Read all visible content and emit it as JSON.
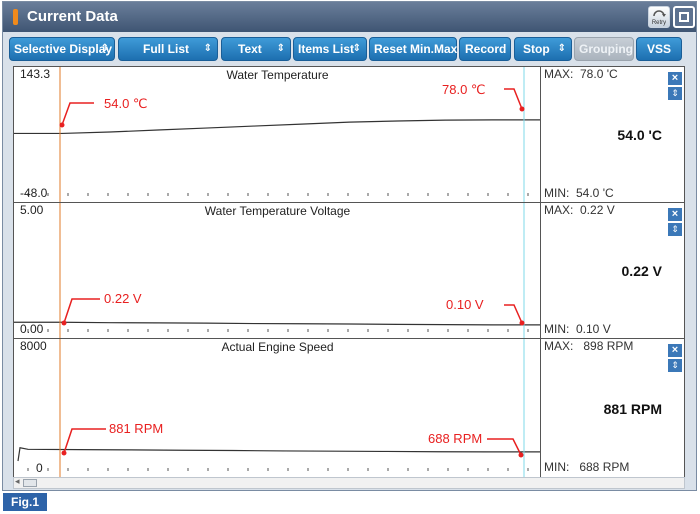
{
  "window": {
    "title": "Current Data",
    "retry_label": "Retry"
  },
  "toolbar": [
    {
      "label": "Selective Display",
      "has_arrows": true,
      "disabled": false
    },
    {
      "label": "Full List",
      "has_arrows": true,
      "disabled": false
    },
    {
      "label": "Text",
      "has_arrows": true,
      "disabled": false
    },
    {
      "label": "Items List",
      "has_arrows": true,
      "disabled": false
    },
    {
      "label": "Reset Min.Max",
      "has_arrows": false,
      "disabled": false
    },
    {
      "label": "Record",
      "has_arrows": false,
      "disabled": false
    },
    {
      "label": "Stop",
      "has_arrows": true,
      "disabled": false
    },
    {
      "label": "Grouping",
      "has_arrows": false,
      "disabled": true
    },
    {
      "label": "VSS",
      "has_arrows": false,
      "disabled": false
    }
  ],
  "colors": {
    "start_cursor": "#e07b2a",
    "end_cursor": "#7fd8e8",
    "annotation": "#e82020",
    "trace": "#333333"
  },
  "chart_data": [
    {
      "type": "line",
      "title": "Water Temperature",
      "ylim": [
        -48.0,
        143.3
      ],
      "y_max_label": "143.3",
      "y_min_label": "-48.0",
      "series": [
        {
          "values": [
            54.0,
            54.0,
            56.5,
            60.0,
            63.5,
            67.0,
            70.5,
            74.0,
            76.0,
            77.5,
            78.0,
            78.0
          ]
        }
      ],
      "stats": {
        "max": "MAX:  78.0 'C",
        "min": "MIN:  54.0 'C",
        "current": "54.0 'C"
      },
      "annotations": {
        "start": "54.0 ℃",
        "end": "78.0 ℃"
      }
    },
    {
      "type": "line",
      "title": "Water Temperature Voltage",
      "ylim": [
        0.0,
        5.0
      ],
      "y_max_label": "5.00",
      "y_min_label": "0.00",
      "series": [
        {
          "values": [
            0.22,
            0.22,
            0.2,
            0.19,
            0.18,
            0.16,
            0.15,
            0.14,
            0.12,
            0.11,
            0.1,
            0.1
          ]
        }
      ],
      "stats": {
        "max": "MAX:  0.22 V",
        "min": "MIN:  0.10 V",
        "current": "0.22 V"
      },
      "annotations": {
        "start": "0.22 V",
        "end": "0.10 V"
      }
    },
    {
      "type": "line",
      "title": "Actual Engine Speed",
      "ylim": [
        0,
        8000
      ],
      "y_max_label": "8000",
      "y_min_label": "0",
      "series": [
        {
          "values": [
            0,
            1000,
            881,
            860,
            840,
            810,
            790,
            760,
            740,
            720,
            700,
            688,
            688
          ]
        }
      ],
      "stats": {
        "max": "MAX:   898 RPM",
        "min": "MIN:   688 RPM",
        "current": "881 RPM"
      },
      "annotations": {
        "start": "881 RPM",
        "end": "688 RPM"
      }
    }
  ],
  "footer": {
    "figure_label": "Fig.1"
  }
}
